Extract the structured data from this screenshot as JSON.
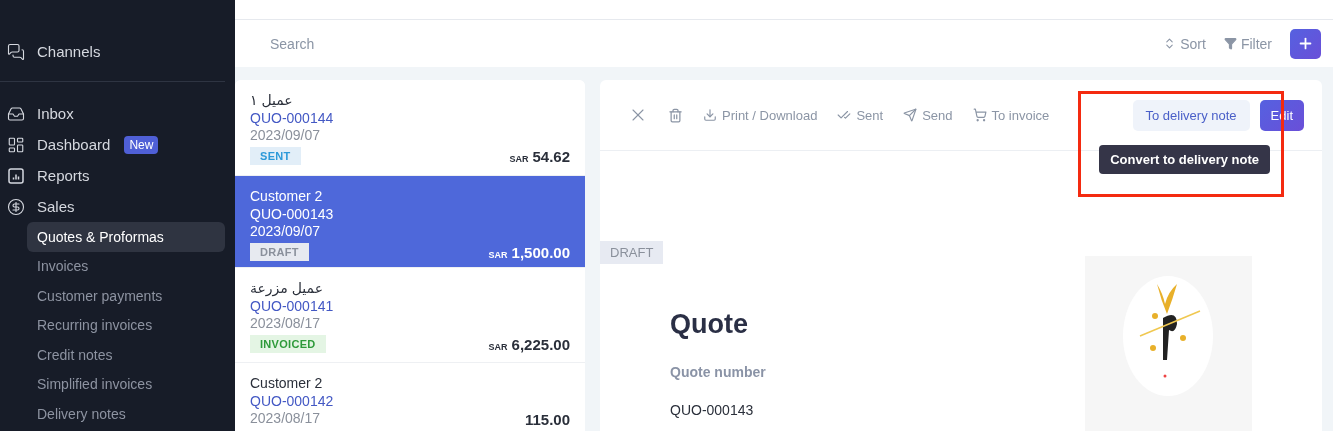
{
  "sidebar": {
    "top_items": [
      {
        "label": "Channels"
      }
    ],
    "items": [
      {
        "label": "Inbox"
      },
      {
        "label": "Dashboard",
        "badge": "New"
      },
      {
        "label": "Reports"
      },
      {
        "label": "Sales",
        "children": [
          {
            "label": "Quotes & Proformas",
            "selected": true
          },
          {
            "label": "Invoices",
            "selected": false
          },
          {
            "label": "Customer payments",
            "selected": false
          },
          {
            "label": "Recurring invoices",
            "selected": false
          },
          {
            "label": "Credit notes",
            "selected": false
          },
          {
            "label": "Simplified invoices",
            "selected": false
          },
          {
            "label": "Delivery notes",
            "selected": false
          }
        ]
      }
    ]
  },
  "list_toolbar": {
    "search": {
      "placeholder": "Search"
    },
    "sort": "Sort",
    "filter": "Filter"
  },
  "quotes": [
    {
      "customer": "عميل ١",
      "number": "QUO-000144",
      "date": "2023/09/07",
      "status": {
        "label": "SENT",
        "kind": "sent"
      },
      "currency": "SAR",
      "amount": "54.62",
      "selected": false
    },
    {
      "customer": "Customer 2",
      "number": "QUO-000143",
      "date": "2023/09/07",
      "status": {
        "label": "DRAFT",
        "kind": "draft"
      },
      "currency": "SAR",
      "amount": "1,500.00",
      "selected": true
    },
    {
      "customer": "عميل مزرعة",
      "number": "QUO-000141",
      "date": "2023/08/17",
      "status": {
        "label": "INVOICED",
        "kind": "invoiced"
      },
      "currency": "SAR",
      "amount": "6,225.00",
      "selected": false
    },
    {
      "customer": "Customer 2",
      "number": "QUO-000142",
      "date": "2023/08/17",
      "amount": "115.00",
      "selected": false
    }
  ],
  "detail_toolbar": {
    "actions": [
      {
        "label": "Print / Download",
        "kind": "download"
      },
      {
        "label": "Sent",
        "kind": "sent"
      },
      {
        "label": "Send",
        "kind": "send"
      },
      {
        "label": "To invoice",
        "kind": "invoice"
      }
    ],
    "buttons": [
      {
        "label": "To delivery note",
        "kind": "soft"
      },
      {
        "label": "Edit",
        "kind": "primary"
      }
    ],
    "tooltip": "Convert to delivery note",
    "highlighted": true
  },
  "document": {
    "ribbon": "DRAFT",
    "title": "Quote",
    "field_label": "Quote number",
    "field_value": "QUO-000143"
  }
}
